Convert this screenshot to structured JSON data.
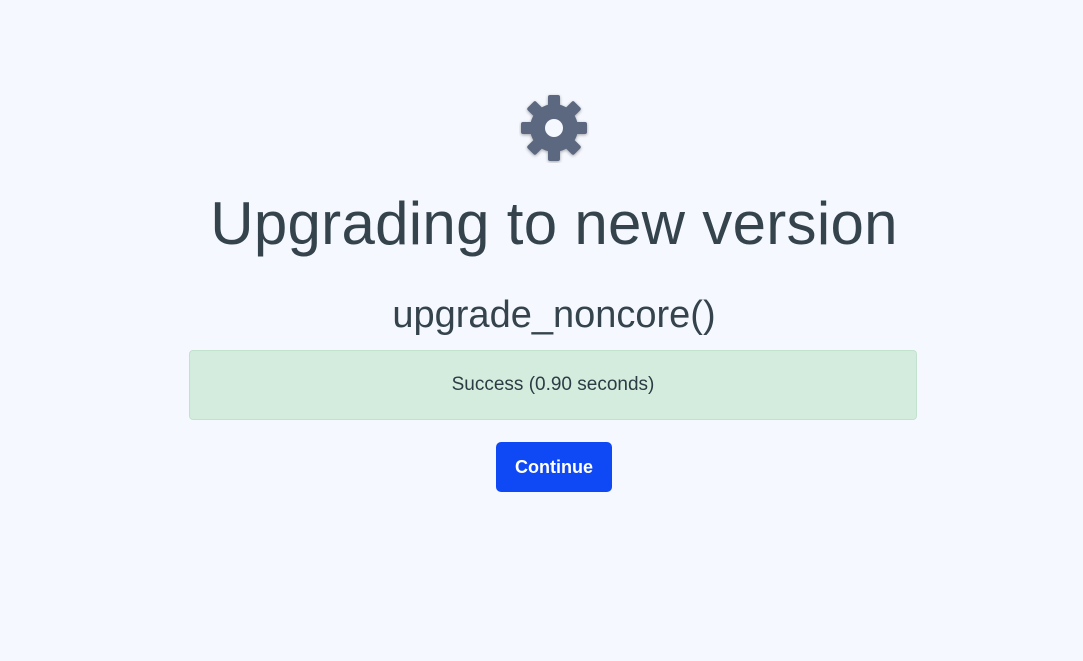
{
  "page": {
    "title": "Upgrading to new version",
    "subtitle": "upgrade_noncore()",
    "icon": "gear-icon"
  },
  "alert": {
    "message": "Success (0.90 seconds)",
    "status": "success"
  },
  "actions": {
    "continue_label": "Continue"
  },
  "colors": {
    "background": "#f5f8fe",
    "text": "#34434c",
    "gear": "#5b6880",
    "success_bg": "#d4ecdd",
    "success_border": "#c2e2cd",
    "primary": "#0f49f5"
  }
}
